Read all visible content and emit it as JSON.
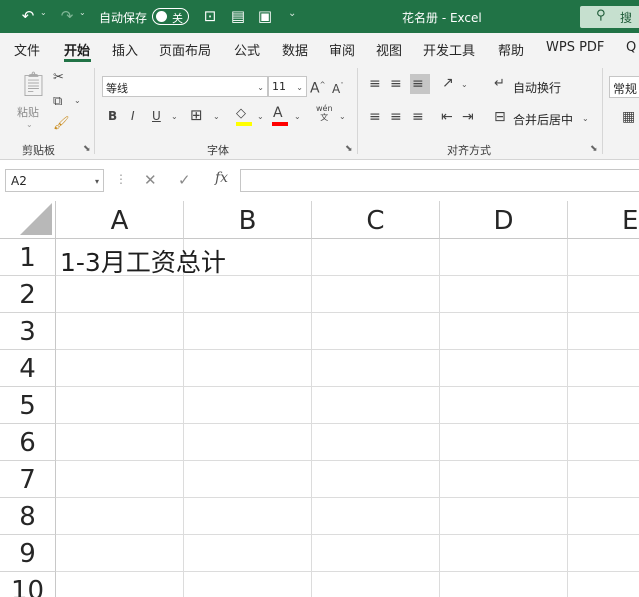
{
  "titlebar": {
    "autosave_label": "自动保存",
    "autosave_state": "关",
    "window_title": "花名册 - Excel",
    "search_text": "搜"
  },
  "menu": {
    "tabs": [
      "文件",
      "开始",
      "插入",
      "页面布局",
      "公式",
      "数据",
      "审阅",
      "视图",
      "开发工具",
      "帮助",
      "WPS PDF",
      "Q"
    ],
    "active_tab": "开始"
  },
  "ribbon": {
    "clipboard": {
      "paste_label": "粘贴",
      "group_label": "剪贴板"
    },
    "font": {
      "font_name": "等线",
      "font_size": "11",
      "bold": "B",
      "italic": "I",
      "underline": "U",
      "phonetic": "wén",
      "phonetic_sub": "文",
      "group_label": "字体"
    },
    "alignment": {
      "wrap_text": "自动换行",
      "merge_center": "合并后居中",
      "group_label": "对齐方式"
    },
    "number": {
      "format": "常规"
    }
  },
  "formula_bar": {
    "name_box": "A2",
    "fx": "fx",
    "formula": ""
  },
  "sheet": {
    "columns": [
      "A",
      "B",
      "C",
      "D",
      "E"
    ],
    "rows": [
      "1",
      "2",
      "3",
      "4",
      "5",
      "6",
      "7",
      "8",
      "9",
      "10"
    ],
    "cell_a1": "1-3月工资总计"
  },
  "colors": {
    "excel_green": "#217346",
    "ribbon_bg": "#f3f3f3",
    "fill_yellow": "#ffff00",
    "font_red": "#ff0000"
  }
}
